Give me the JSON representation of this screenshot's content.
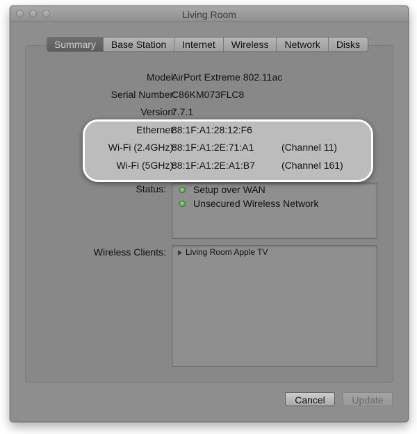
{
  "window": {
    "title": "Living Room"
  },
  "tabs": [
    {
      "label": "Summary",
      "selected": true
    },
    {
      "label": "Base Station",
      "selected": false
    },
    {
      "label": "Internet",
      "selected": false
    },
    {
      "label": "Wireless",
      "selected": false
    },
    {
      "label": "Network",
      "selected": false
    },
    {
      "label": "Disks",
      "selected": false
    }
  ],
  "summary": {
    "model_label": "Model:",
    "model_value": "AirPort Extreme 802.11ac",
    "serial_label": "Serial Number:",
    "serial_value": "C86KM073FLC8",
    "version_label": "Version:",
    "version_value": "7.7.1",
    "ethernet_label": "Ethernet:",
    "ethernet_value": "88:1F:A1:28:12:F6",
    "wifi24_label": "Wi-Fi (2.4GHz):",
    "wifi24_value": "88:1F:A1:2E:71:A1",
    "wifi24_channel": "(Channel 11)",
    "wifi5_label": "Wi-Fi (5GHz):",
    "wifi5_value": "88:1F:A1:2E:A1:B7",
    "wifi5_channel": "(Channel 161)"
  },
  "status": {
    "label": "Status:",
    "items": [
      "Setup over WAN",
      "Unsecured Wireless Network"
    ],
    "indicator_color": "#4caf3a"
  },
  "clients": {
    "label": "Wireless Clients:",
    "items": [
      "Living Room Apple TV"
    ]
  },
  "buttons": {
    "cancel": "Cancel",
    "update": "Update"
  }
}
